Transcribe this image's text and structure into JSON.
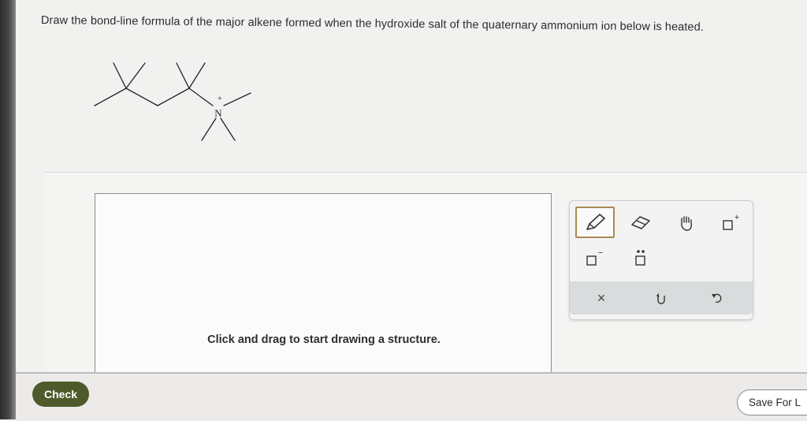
{
  "question": {
    "text": "Draw the bond-line formula of the major alkene formed when the hydroxide salt of the quaternary ammonium ion below is heated."
  },
  "molecule": {
    "nitrogen_label": "N",
    "charge_label": "+"
  },
  "canvas": {
    "hint": "Click and drag to start drawing a structure."
  },
  "toolbar": {
    "tools": [
      {
        "name": "pencil",
        "icon": "pencil-icon",
        "active": true
      },
      {
        "name": "eraser",
        "icon": "eraser-icon"
      },
      {
        "name": "pan",
        "icon": "hand-icon"
      },
      {
        "name": "add-positive-charge",
        "icon": "plus-charge-icon",
        "label": "+"
      },
      {
        "name": "add-negative-charge",
        "icon": "minus-charge-icon",
        "label": "−"
      },
      {
        "name": "add-lone-pair",
        "icon": "lone-pair-icon"
      },
      {
        "name": "clear",
        "icon": "x-icon",
        "label": "×"
      },
      {
        "name": "undo",
        "icon": "undo-icon"
      },
      {
        "name": "redo",
        "icon": "redo-icon"
      }
    ]
  },
  "footer": {
    "check_label": "Check",
    "save_label": "Save For L"
  },
  "colors": {
    "check_button": "#4e5a2a",
    "active_tool_border": "#a88a52"
  }
}
